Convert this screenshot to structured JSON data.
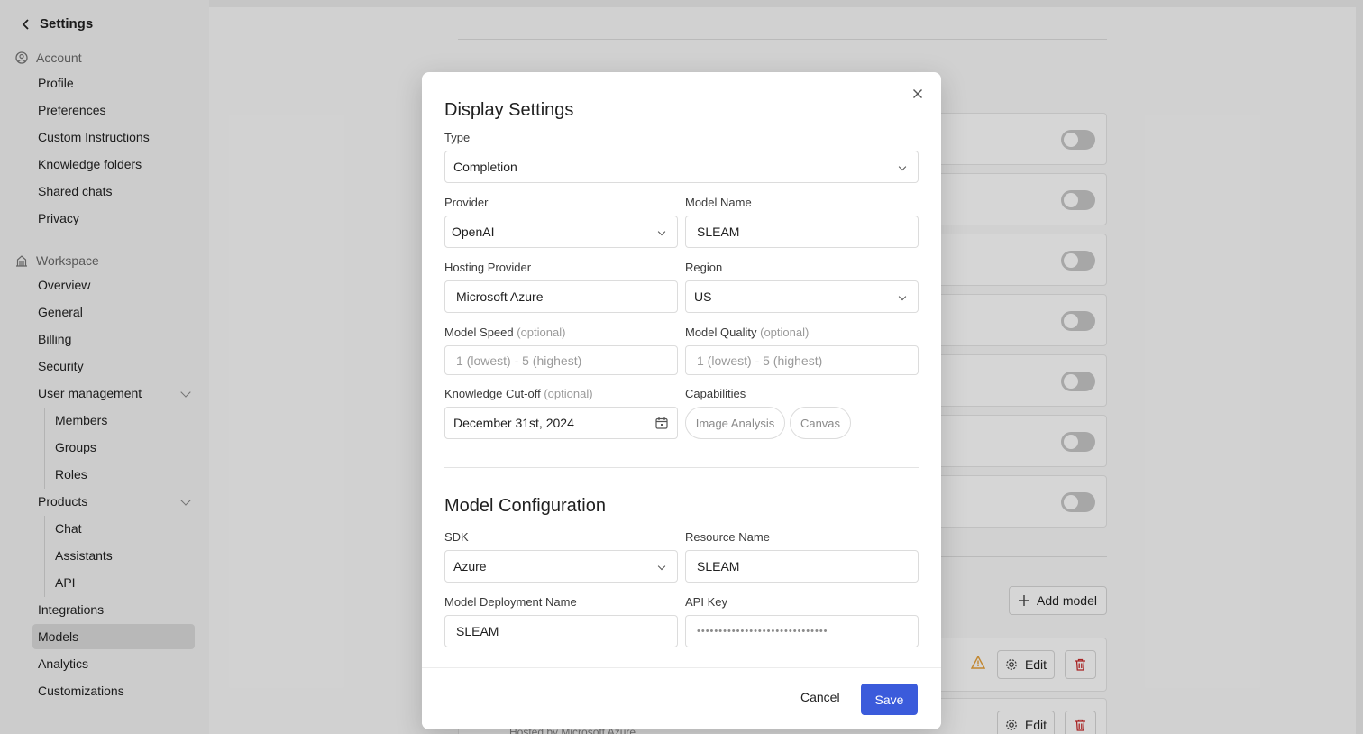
{
  "sidebar": {
    "back_label": "Settings",
    "account_section": "Account",
    "account_items": [
      "Profile",
      "Preferences",
      "Custom Instructions",
      "Knowledge folders",
      "Shared chats",
      "Privacy"
    ],
    "workspace_section": "Workspace",
    "workspace_items": {
      "overview": "Overview",
      "general": "General",
      "billing": "Billing",
      "security": "Security",
      "user_management": "User management",
      "members": "Members",
      "groups": "Groups",
      "roles": "Roles",
      "products": "Products",
      "chat": "Chat",
      "assistants": "Assistants",
      "api": "API",
      "integrations": "Integrations",
      "models": "Models",
      "analytics": "Analytics",
      "customizations": "Customizations"
    }
  },
  "background": {
    "add_model_label": "Add model",
    "edit_label": "Edit",
    "hosted_by": "Hosted by Microsoft Azure"
  },
  "modal": {
    "title": "Display Settings",
    "type_label": "Type",
    "type_value": "Completion",
    "provider_label": "Provider",
    "provider_value": "OpenAI",
    "model_name_label": "Model Name",
    "model_name_value": "SLEAM",
    "hosting_provider_label": "Hosting Provider",
    "hosting_provider_value": "Microsoft Azure",
    "region_label": "Region",
    "region_value": "US",
    "model_speed_label": "Model Speed",
    "model_speed_placeholder": "1 (lowest) - 5 (highest)",
    "model_quality_label": "Model Quality",
    "model_quality_placeholder": "1 (lowest) - 5 (highest)",
    "optional_tag": "(optional)",
    "knowledge_cutoff_label": "Knowledge Cut-off",
    "knowledge_cutoff_value": "December 31st, 2024",
    "capabilities_label": "Capabilities",
    "capabilities": [
      "Image Analysis",
      "Canvas"
    ],
    "config_title": "Model Configuration",
    "sdk_label": "SDK",
    "sdk_value": "Azure",
    "resource_name_label": "Resource Name",
    "resource_name_value": "SLEAM",
    "deployment_name_label": "Model Deployment Name",
    "deployment_name_value": "SLEAM",
    "api_key_label": "API Key",
    "api_key_masked": "••••••••••••••••••••••••••••••",
    "cancel_label": "Cancel",
    "save_label": "Save"
  },
  "colors": {
    "accent": "#3b5bdb",
    "warning": "#e8a13a",
    "danger": "#c92a2a"
  }
}
